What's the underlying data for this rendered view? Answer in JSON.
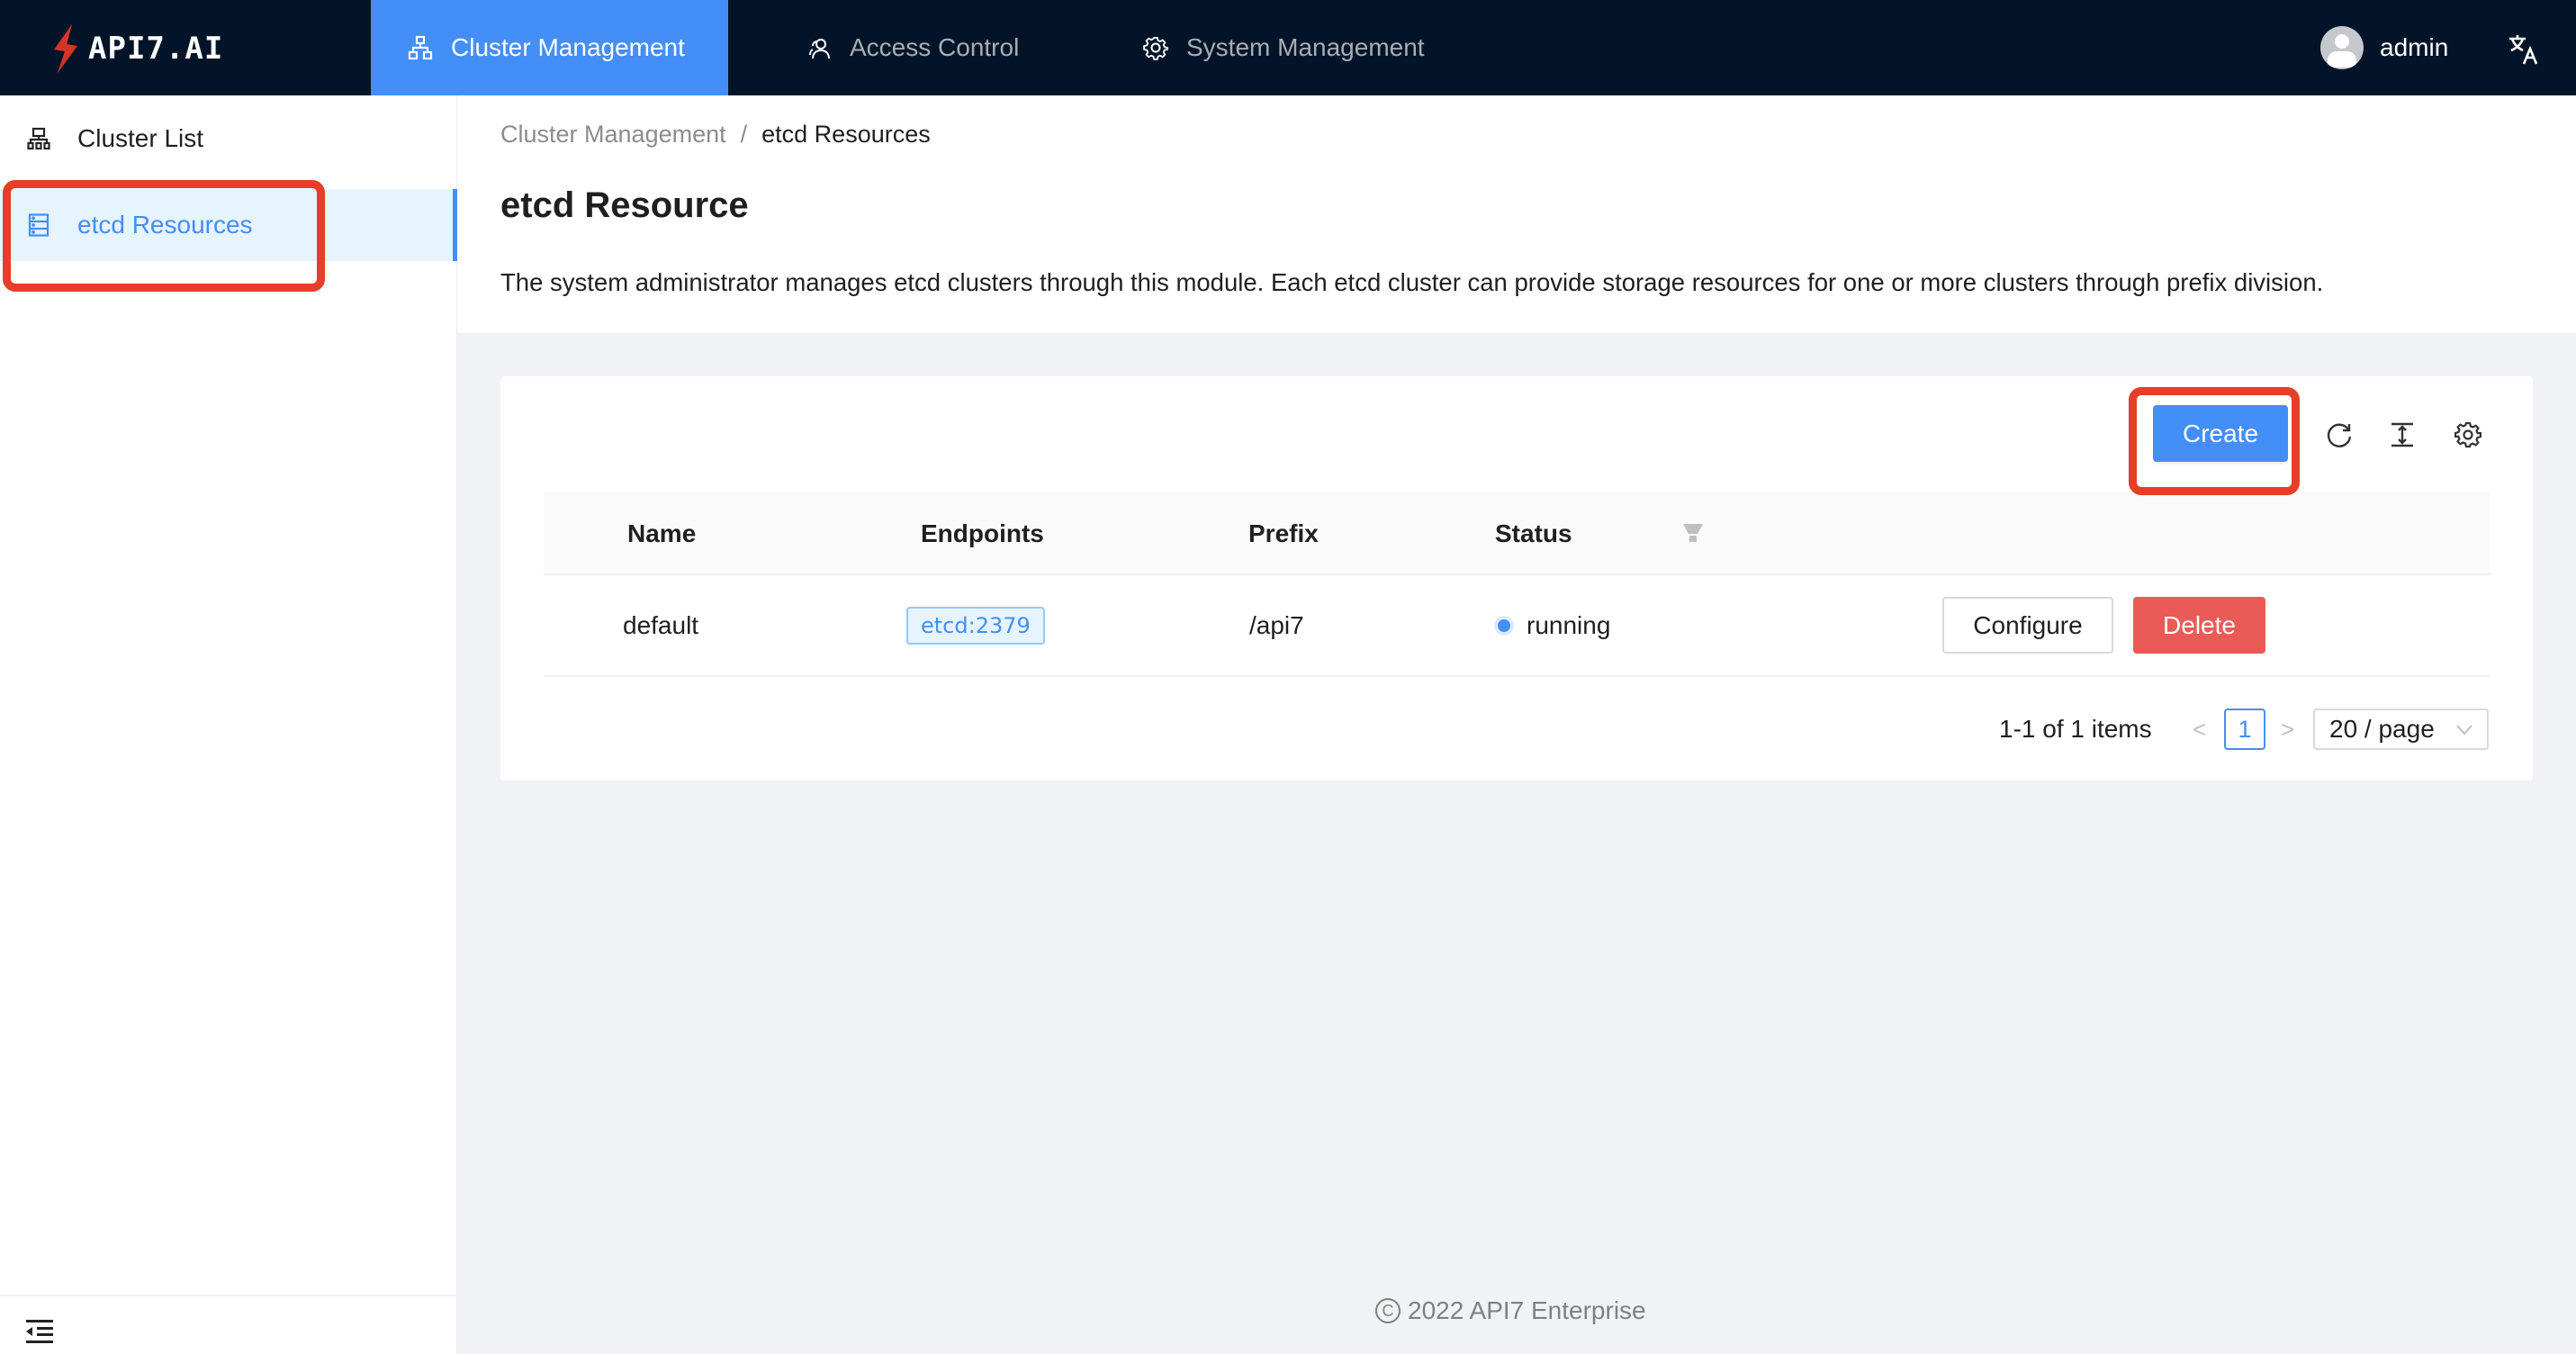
{
  "header": {
    "logo_text": "API7.AI",
    "tabs": [
      {
        "label": "Cluster Management",
        "icon": "cluster-icon",
        "active": true
      },
      {
        "label": "Access Control",
        "icon": "users-icon",
        "active": false
      },
      {
        "label": "System Management",
        "icon": "gear-icon",
        "active": false
      }
    ],
    "user_name": "admin",
    "language_icon": "translate-icon"
  },
  "sidebar": {
    "items": [
      {
        "label": "Cluster List",
        "icon": "cluster-list-icon",
        "selected": false
      },
      {
        "label": "etcd Resources",
        "icon": "database-icon",
        "selected": true
      }
    ],
    "collapse_icon": "menu-fold-icon"
  },
  "breadcrumb": {
    "items": [
      "Cluster Management",
      "etcd Resources"
    ],
    "separator": "/"
  },
  "page": {
    "title": "etcd Resource",
    "description": "The system administrator manages etcd clusters through this module. Each etcd cluster can provide storage resources for one or more clusters through prefix division."
  },
  "toolbar": {
    "create_label": "Create",
    "reload_icon": "reload-icon",
    "density_icon": "column-height-icon",
    "settings_icon": "setting-icon"
  },
  "table": {
    "columns": [
      "Name",
      "Endpoints",
      "Prefix",
      "Status"
    ],
    "rows": [
      {
        "name": "default",
        "endpoints": [
          "etcd:2379"
        ],
        "prefix": "/api7",
        "status": "running",
        "actions": {
          "configure": "Configure",
          "delete": "Delete"
        }
      }
    ]
  },
  "pagination": {
    "total_text": "1-1 of 1 items",
    "current_page": "1",
    "page_size": "20 / page",
    "prev": "<",
    "next": ">"
  },
  "footer": {
    "copyright_symbol": "C",
    "text": "2022 API7 Enterprise"
  },
  "colors": {
    "primary": "#448ef7",
    "header_bg": "#041428",
    "danger": "#ea5b57",
    "annotation": "#e63e28"
  }
}
